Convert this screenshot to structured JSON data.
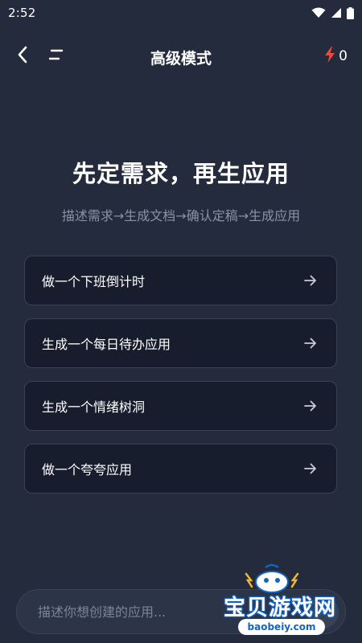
{
  "status_bar": {
    "time": "2:52",
    "icons": [
      "wifi-icon",
      "cellular-signal-icon",
      "battery-icon"
    ]
  },
  "nav": {
    "title": "高级模式",
    "credits_count": "0",
    "icons": [
      "back-arrow-icon",
      "menu-icon",
      "lightning-icon"
    ]
  },
  "hero": {
    "title": "先定需求，再生应用",
    "subtitle": "描述需求→生成文档→确认定稿→生成应用"
  },
  "suggestions": [
    {
      "label": "做一个下班倒计时"
    },
    {
      "label": "生成一个每日待办应用"
    },
    {
      "label": "生成一个情绪树洞"
    },
    {
      "label": "做一个夸夸应用"
    }
  ],
  "input": {
    "placeholder": "描述你想创建的应用..."
  },
  "watermark": {
    "text": "宝贝游戏网",
    "url": "baobeiy.com"
  },
  "colors": {
    "background": "#232b3c",
    "card": "#171d2c",
    "accent_lightning": "#e94b3c",
    "muted_text": "#8a92a6"
  }
}
